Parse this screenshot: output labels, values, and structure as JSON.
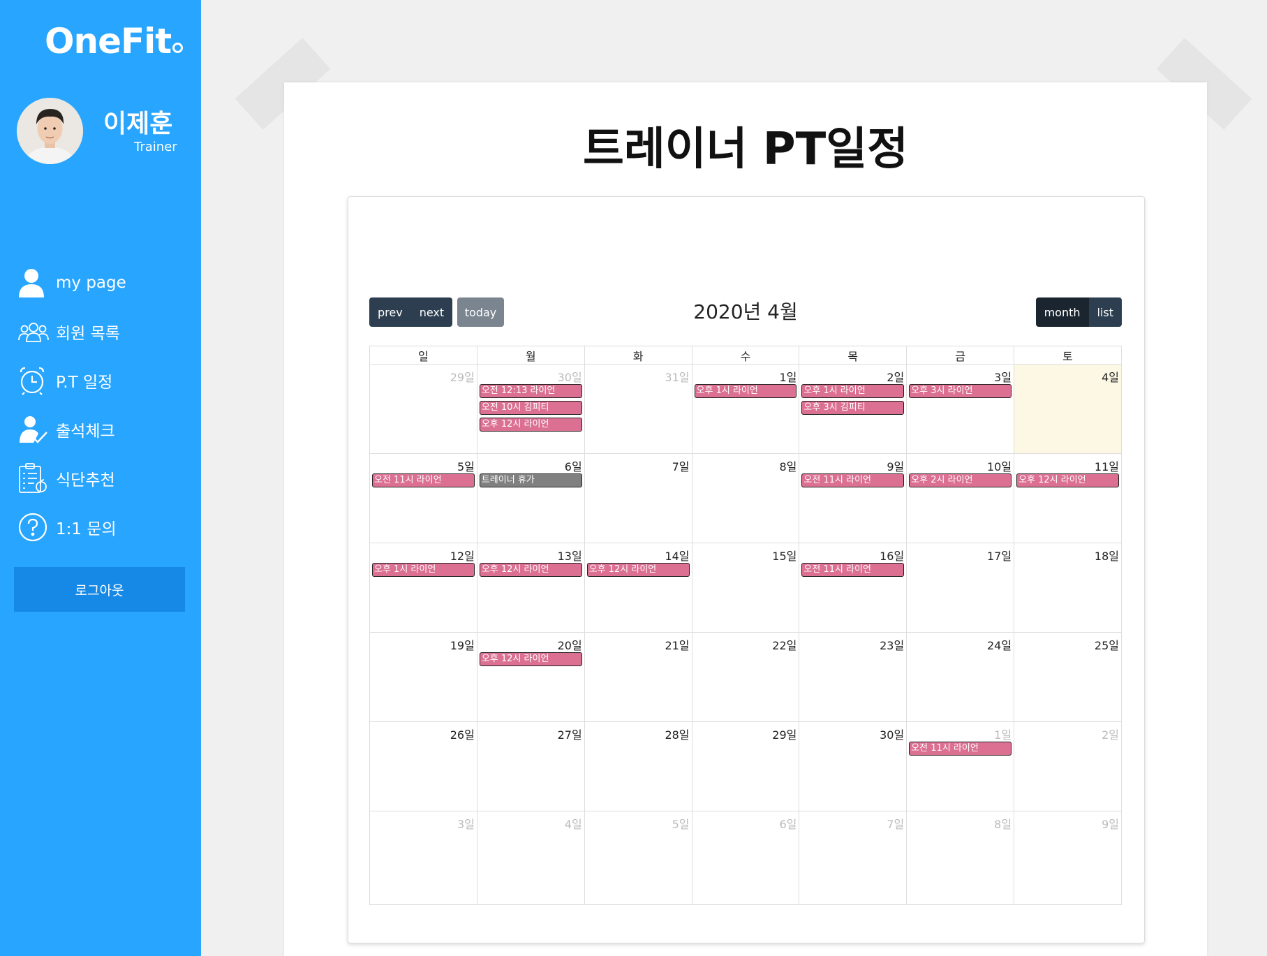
{
  "brand": {
    "name": "OneFit"
  },
  "profile": {
    "name": "이제훈",
    "role": "Trainer"
  },
  "menu": [
    {
      "label": "my page",
      "icon": "user-icon"
    },
    {
      "label": "회원 목록",
      "icon": "users-icon"
    },
    {
      "label": "P.T 일정",
      "icon": "alarm-clock-icon"
    },
    {
      "label": "출석체크",
      "icon": "user-check-icon"
    },
    {
      "label": "식단추천",
      "icon": "clipboard-list-icon"
    },
    {
      "label": "1:1 문의",
      "icon": "question-circle-icon"
    }
  ],
  "logout_label": "로그아웃",
  "page": {
    "title": "트레이너 PT일정"
  },
  "calendar": {
    "title": "2020년 4월",
    "buttons": {
      "prev": "prev",
      "next": "next",
      "today": "today",
      "month": "month",
      "list": "list"
    },
    "weekdays": [
      "일",
      "월",
      "화",
      "수",
      "목",
      "금",
      "토"
    ],
    "weeks": [
      [
        {
          "day": "29일",
          "other": true,
          "events": []
        },
        {
          "day": "30일",
          "other": true,
          "events": [
            {
              "text": "오전 12:13 라이언"
            },
            {
              "text": "오전 10시 김피티"
            },
            {
              "text": "오후 12시 라이언"
            }
          ]
        },
        {
          "day": "31일",
          "other": true,
          "events": []
        },
        {
          "day": "1일",
          "events": [
            {
              "text": "오후 1시 라이언"
            }
          ]
        },
        {
          "day": "2일",
          "events": [
            {
              "text": "오후 1시 라이언"
            },
            {
              "text": "오후 3시 김피티"
            }
          ]
        },
        {
          "day": "3일",
          "events": [
            {
              "text": "오후 3시 라이언"
            }
          ]
        },
        {
          "day": "4일",
          "today": true,
          "events": []
        }
      ],
      [
        {
          "day": "5일",
          "events": [
            {
              "text": "오전 11시 라이언"
            }
          ]
        },
        {
          "day": "6일",
          "events": [
            {
              "text": "트레이너 휴가",
              "gray": true
            }
          ]
        },
        {
          "day": "7일",
          "events": []
        },
        {
          "day": "8일",
          "events": []
        },
        {
          "day": "9일",
          "events": [
            {
              "text": "오전 11시 라이언"
            }
          ]
        },
        {
          "day": "10일",
          "events": [
            {
              "text": "오후 2시 라이언"
            }
          ]
        },
        {
          "day": "11일",
          "events": [
            {
              "text": "오후 12시 라이언"
            }
          ]
        }
      ],
      [
        {
          "day": "12일",
          "events": [
            {
              "text": "오후 1시 라이언"
            }
          ]
        },
        {
          "day": "13일",
          "events": [
            {
              "text": "오후 12시 라이언"
            }
          ]
        },
        {
          "day": "14일",
          "events": [
            {
              "text": "오후 12시 라이언"
            }
          ]
        },
        {
          "day": "15일",
          "events": []
        },
        {
          "day": "16일",
          "events": [
            {
              "text": "오전 11시 라이언"
            }
          ]
        },
        {
          "day": "17일",
          "events": []
        },
        {
          "day": "18일",
          "events": []
        }
      ],
      [
        {
          "day": "19일",
          "events": []
        },
        {
          "day": "20일",
          "events": [
            {
              "text": "오후 12시 라이언"
            }
          ]
        },
        {
          "day": "21일",
          "events": []
        },
        {
          "day": "22일",
          "events": []
        },
        {
          "day": "23일",
          "events": []
        },
        {
          "day": "24일",
          "events": []
        },
        {
          "day": "25일",
          "events": []
        }
      ],
      [
        {
          "day": "26일",
          "events": []
        },
        {
          "day": "27일",
          "events": []
        },
        {
          "day": "28일",
          "events": []
        },
        {
          "day": "29일",
          "events": []
        },
        {
          "day": "30일",
          "events": []
        },
        {
          "day": "1일",
          "other": true,
          "events": [
            {
              "text": "오전 11시 라이언"
            }
          ]
        },
        {
          "day": "2일",
          "other": true,
          "events": []
        }
      ],
      [
        {
          "day": "3일",
          "other": true,
          "events": []
        },
        {
          "day": "4일",
          "other": true,
          "events": []
        },
        {
          "day": "5일",
          "other": true,
          "events": []
        },
        {
          "day": "6일",
          "other": true,
          "events": []
        },
        {
          "day": "7일",
          "other": true,
          "events": []
        },
        {
          "day": "8일",
          "other": true,
          "events": []
        },
        {
          "day": "9일",
          "other": true,
          "events": []
        }
      ]
    ]
  }
}
